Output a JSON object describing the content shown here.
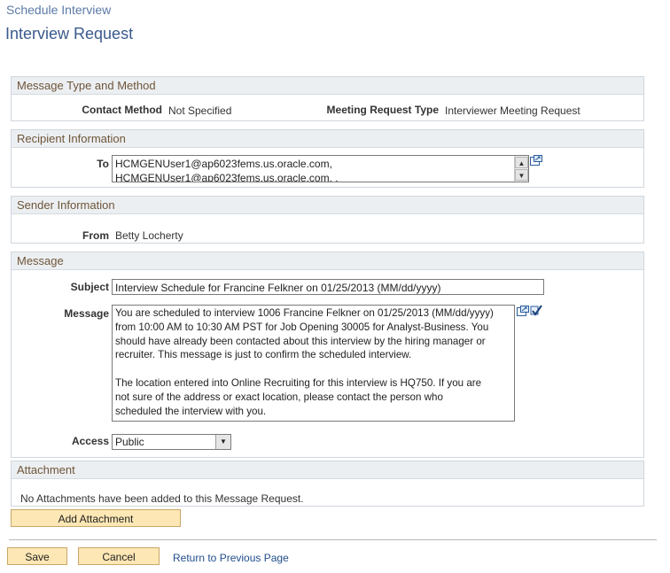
{
  "header": {
    "breadcrumb": "Schedule Interview",
    "title": "Interview Request"
  },
  "message_type": {
    "heading": "Message Type and Method",
    "contact_method_label": "Contact Method",
    "contact_method_value": "Not Specified",
    "meeting_type_label": "Meeting Request Type",
    "meeting_type_value": "Interviewer Meeting Request"
  },
  "recipient": {
    "heading": "Recipient Information",
    "to_label": "To",
    "to_line1": "HCMGENUser1@ap6023fems.us.oracle.com,",
    "to_line2": "HCMGENUser1@ap6023fems.us.oracle.com, ,"
  },
  "sender": {
    "heading": "Sender Information",
    "from_label": "From",
    "from_value": "Betty Locherty"
  },
  "message": {
    "heading": "Message",
    "subject_label": "Subject",
    "subject_value": "Interview Schedule for Francine Felkner on 01/25/2013 (MM/dd/yyyy)",
    "message_label": "Message",
    "body_lines": [
      "You are scheduled to interview 1006 Francine Felkner on 01/25/2013 (MM/dd/yyyy)",
      "from 10:00 AM to 10:30 AM PST for Job Opening 30005 for Analyst-Business. You",
      "should have already been contacted about this interview by the hiring manager or",
      "recruiter. This message is just to confirm the scheduled interview.",
      "",
      "The location entered into Online Recruiting for this interview is HQ750. If you are",
      "not sure of the address or exact location, please contact the person who",
      "scheduled the interview with you."
    ],
    "access_label": "Access",
    "access_value": "Public"
  },
  "attachment": {
    "heading": "Attachment",
    "empty_text": "No Attachments have been added to this Message Request.",
    "add_button": "Add Attachment"
  },
  "footer": {
    "save": "Save",
    "cancel": "Cancel",
    "return_link": "Return to Previous Page"
  },
  "icons": {
    "expand": "expand-field-icon",
    "spellcheck": "spell-check-icon"
  },
  "colors": {
    "button_bg": "#fde7b4",
    "heading_text": "#6e5538",
    "link": "#1f4d8c"
  }
}
